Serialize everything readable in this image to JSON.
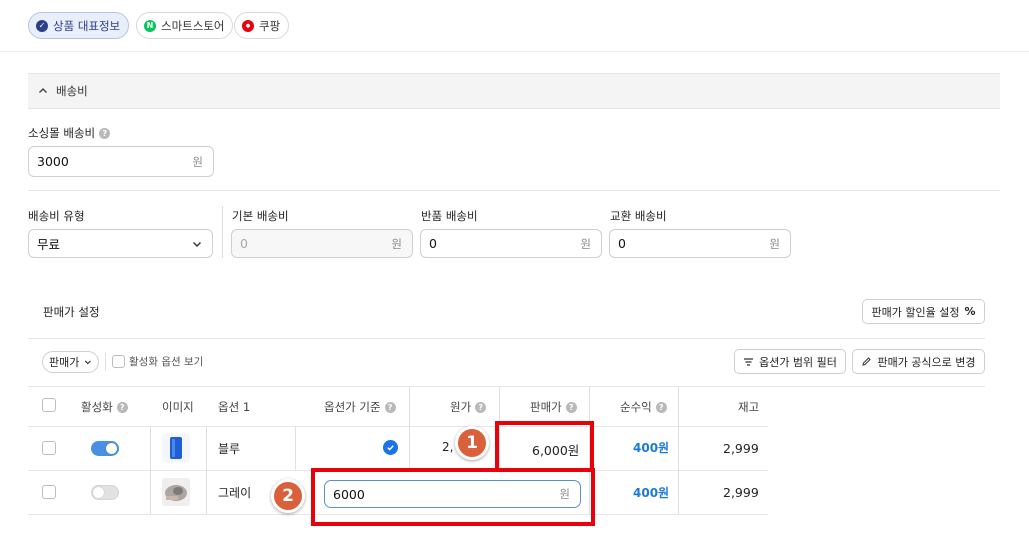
{
  "tabs": [
    {
      "label": "상품 대표정보",
      "icon": "check-circle-icon",
      "color": "#2c3e8c"
    },
    {
      "label": "스마트스토어",
      "icon": "naver-n-icon",
      "color": "#03c75a"
    },
    {
      "label": "쿠팡",
      "icon": "coupang-icon",
      "color": "#e8000b"
    }
  ],
  "shipping": {
    "section_title": "배송비",
    "small_item_fee_label": "소싱몰 배송비",
    "small_item_fee_value": "3000",
    "unit": "원",
    "type_label": "배송비 유형",
    "type_value": "무료",
    "base_fee_label": "기본 배송비",
    "base_fee_value": "0",
    "return_fee_label": "반품 배송비",
    "return_fee_value": "0",
    "exchange_fee_label": "교환 배송비",
    "exchange_fee_value": "0"
  },
  "price_settings": {
    "title": "판매가 설정",
    "discount_button": "판매가 할인율 설정",
    "filter_dropdown": "판매가",
    "active_only_label": "활성화 옵션 보기",
    "range_filter_button": "옵션가 범위 필터",
    "formula_button": "판매가 공식으로 변경"
  },
  "table": {
    "headers": {
      "active": "활성화",
      "image": "이미지",
      "option1": "옵션 1",
      "base_option": "옵션가 기준",
      "cost": "원가",
      "price": "판매가",
      "profit": "순수익",
      "stock": "재고"
    },
    "rows": [
      {
        "active": true,
        "option1": "블루",
        "is_base": true,
        "cost": "2,",
        "price": "6,000원",
        "profit": "400원",
        "stock": "2,999"
      },
      {
        "active": false,
        "option1": "그레이",
        "is_base": false,
        "price_input": "6000",
        "price_unit": "원",
        "profit": "400원",
        "stock": "2,999"
      }
    ]
  },
  "annotations": {
    "badge1": "1",
    "badge2": "2",
    "highlight_color": "#e8000b",
    "badge_color": "#d9603b"
  },
  "colors": {
    "accent": "#4a90e2",
    "profit": "#1a7ad8"
  }
}
